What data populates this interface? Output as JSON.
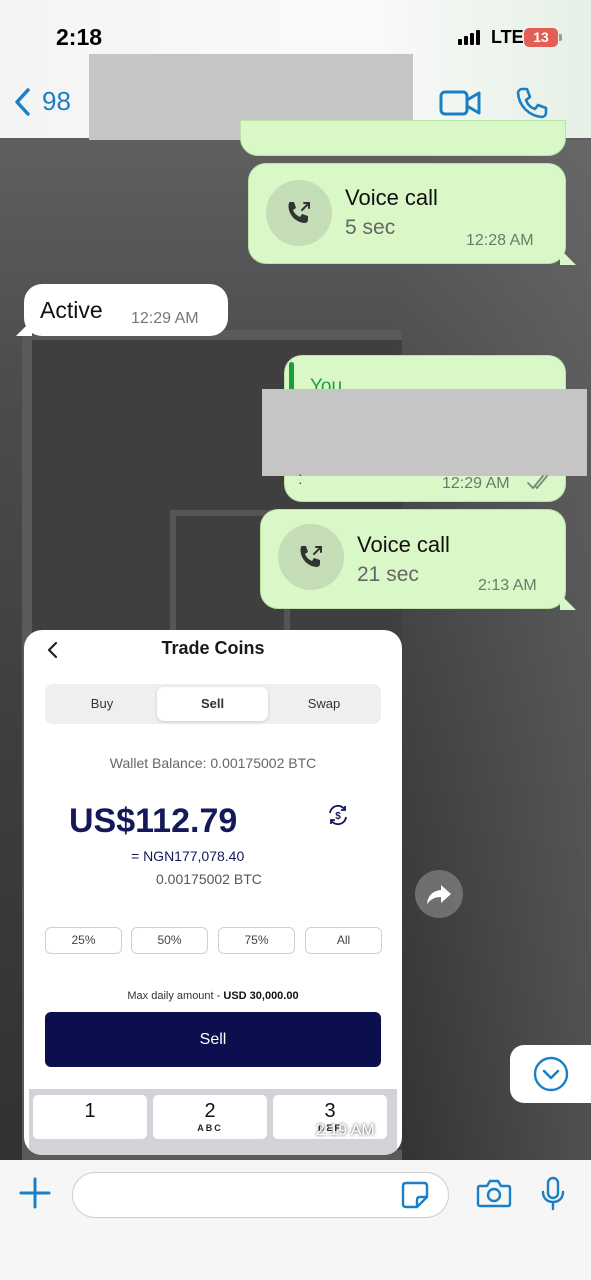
{
  "status_bar": {
    "time": "2:18",
    "network": "LTE",
    "battery": "13"
  },
  "header": {
    "back_count": "98"
  },
  "messages": [
    {
      "type": "outgoing-call",
      "title": "Voice call",
      "duration": "5 sec",
      "time": "12:28 AM"
    },
    {
      "type": "incoming-text",
      "text": "Active",
      "time": "12:29 AM"
    },
    {
      "type": "outgoing-reply",
      "reply_name": "You",
      "time": "12:29 AM"
    },
    {
      "type": "outgoing-call",
      "title": "Voice call",
      "duration": "21 sec",
      "time": "2:13 AM"
    }
  ],
  "image_message": {
    "time": "2:19 AM",
    "title": "Trade Coins",
    "tabs": [
      "Buy",
      "Sell",
      "Swap"
    ],
    "active_tab": "Sell",
    "wallet_balance": "Wallet Balance: 0.00175002 BTC",
    "usd_amount": "US$112.79",
    "ngn_amount": "= NGN177,078.40",
    "btc_amount": "0.00175002 BTC",
    "percent_buttons": [
      "25%",
      "50%",
      "75%",
      "All"
    ],
    "max_daily_label": "Max daily amount - ",
    "max_daily_value": "USD 30,000.00",
    "sell_button": "Sell",
    "keypad": [
      {
        "num": "1",
        "letters": ""
      },
      {
        "num": "2",
        "letters": "ABC"
      },
      {
        "num": "3",
        "letters": "DEF"
      }
    ]
  },
  "input": {
    "placeholder": ""
  },
  "colors": {
    "accent": "#1a7fc4",
    "outgoing_bubble": "#d9f7c7",
    "sell_button": "#0c0f4e",
    "reply_name": "#1b9e3b"
  }
}
